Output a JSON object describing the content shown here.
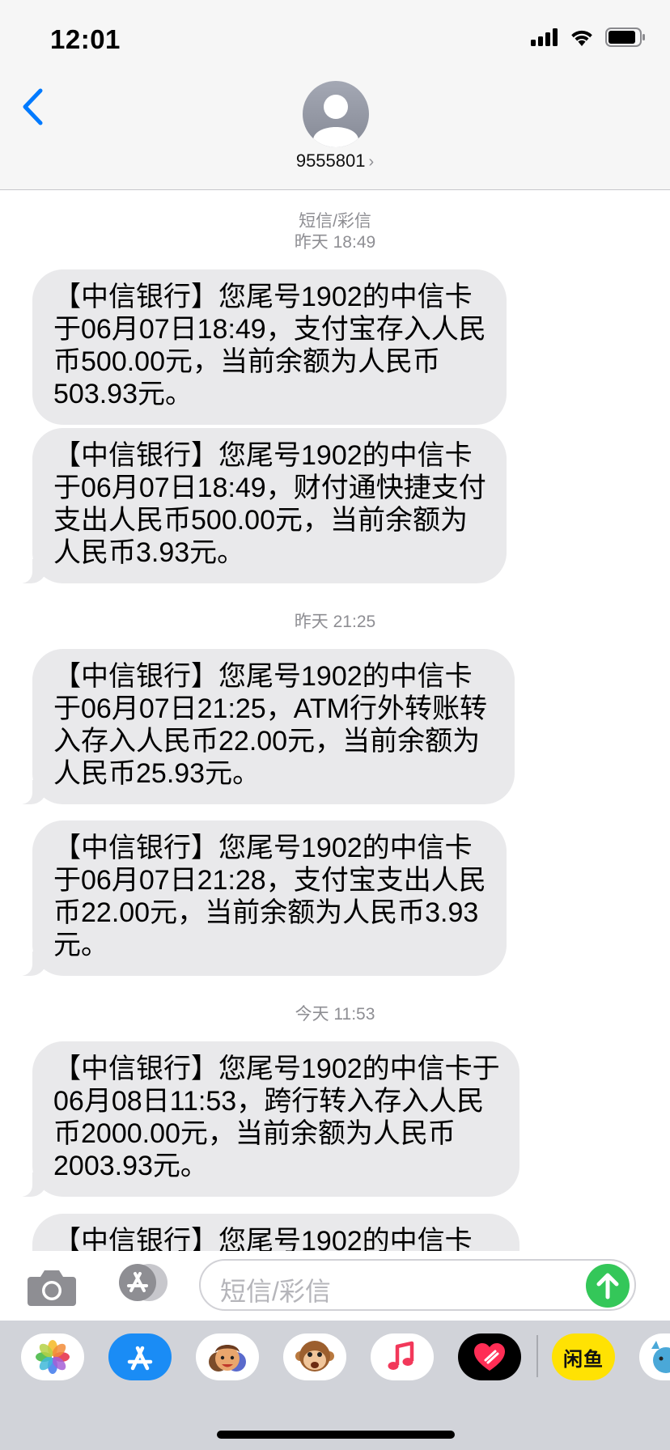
{
  "status_bar": {
    "time": "12:01"
  },
  "header": {
    "contact": "9555801",
    "chevron": "›"
  },
  "conversation": {
    "groups": [
      {
        "timestamp_service": "短信/彩信",
        "timestamp": "昨天 18:49",
        "messages": [
          "【中信银行】您尾号1902的中信卡于06月07日18:49，支付宝存入人民币500.00元，当前余额为人民币503.93元。",
          "【中信银行】您尾号1902的中信卡于06月07日18:49，财付通快捷支付支出人民币500.00元，当前余额为人民币3.93元。"
        ]
      },
      {
        "timestamp": "昨天 21:25",
        "messages": [
          "【中信银行】您尾号1902的中信卡于06月07日21:25，ATM行外转账转入存入人民币22.00元，当前余额为人民币25.93元。",
          "【中信银行】您尾号1902的中信卡于06月07日21:28，支付宝支出人民币22.00元，当前余额为人民币3.93元。"
        ]
      },
      {
        "timestamp": "今天 11:53",
        "messages": [
          "【中信银行】您尾号1902的中信卡于06月08日11:53，跨行转入存入人民币2000.00元，当前余额为人民币2003.93元。",
          "【中信银行】您尾号1902的中信卡"
        ]
      }
    ]
  },
  "input": {
    "placeholder": "短信/彩信"
  },
  "app_drawer": {
    "apps": [
      "photos-app",
      "app-store-app",
      "memoji-app",
      "animoji-app",
      "music-app",
      "heart-app",
      "xianyu-app",
      "partial-app"
    ],
    "xianyu_label": "闲鱼"
  },
  "colors": {
    "accent": "#007aff",
    "send": "#34c759",
    "bubble": "#e9e9eb",
    "header_bg": "#f6f6f6"
  }
}
